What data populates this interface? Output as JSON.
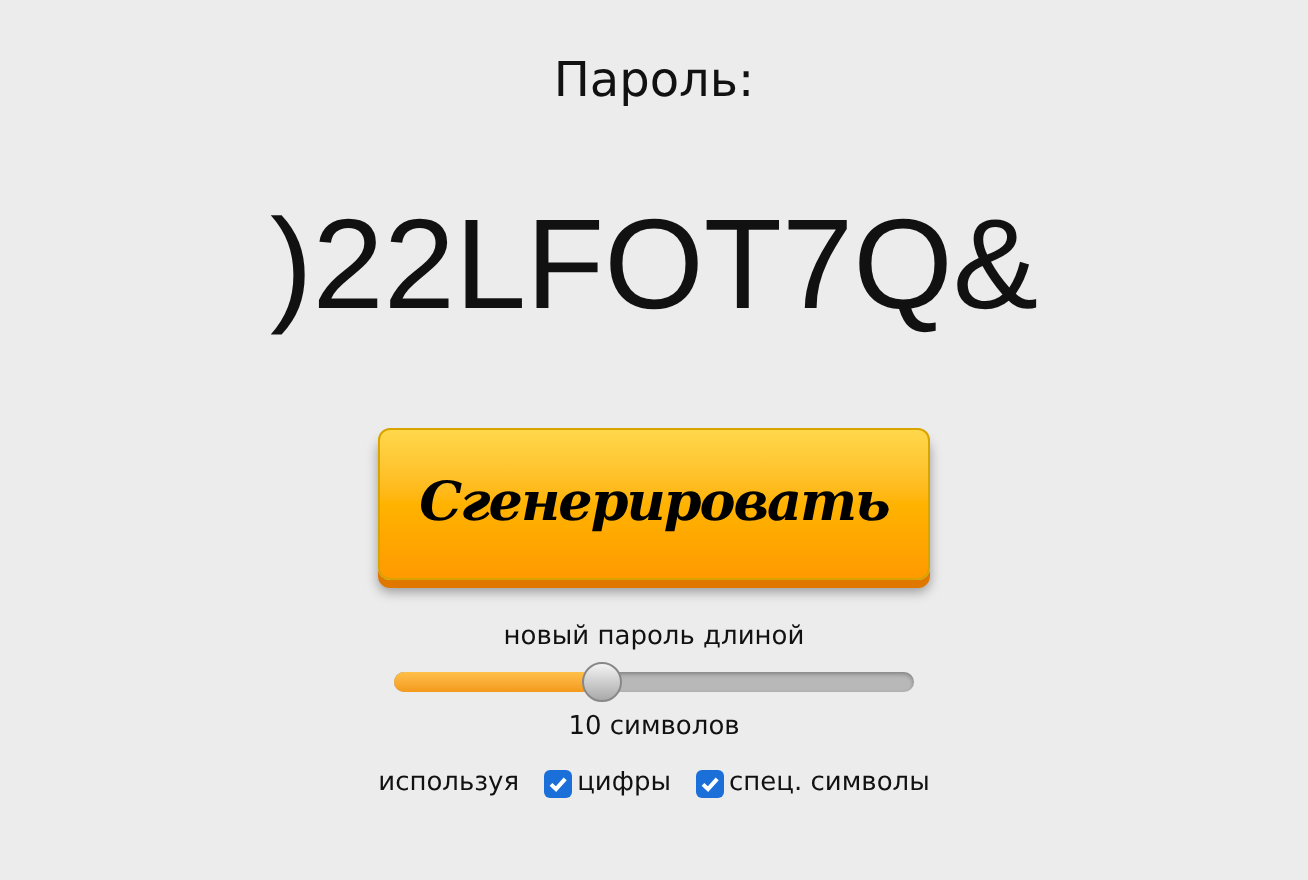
{
  "heading": "Пароль:",
  "password": ")22LFOT7Q&",
  "generate_button": {
    "label": "Сгенерировать"
  },
  "length_label": "новый пароль длиной",
  "length_slider": {
    "level": 0.4
  },
  "length_reading": "10 символов",
  "options_label": "используя",
  "options": [
    {
      "label": "цифры",
      "checked": true
    },
    {
      "label": "спец. символы",
      "checked": true
    }
  ]
}
